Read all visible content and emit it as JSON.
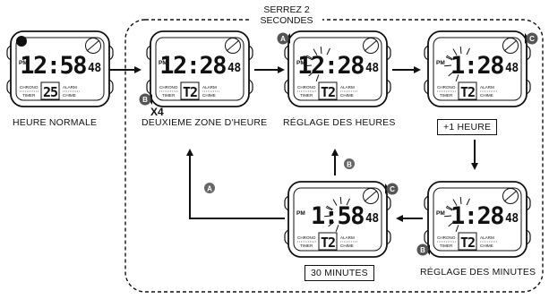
{
  "title_line1": "SERREZ 2",
  "title_line2": "SECONDES",
  "labels": {
    "normal": "HEURE NORMALE",
    "second_zone": "DEUXIEME ZONE D'HEURE",
    "hours_setting": "RÉGLAGE DES HEURES",
    "plus_one_hour": "+1 HEURE",
    "minutes_setting": "RÉGLAGE DES MINUTES",
    "thirty_minutes": "30 MINUTES",
    "x4": "X4"
  },
  "buttons": {
    "a": "A",
    "b": "B",
    "c": "C"
  },
  "watches": [
    {
      "pm": "PM",
      "time": "12:58",
      "sec": "48",
      "mode_left_top": "CHRONO",
      "mode_left_bottom": "TIMER",
      "sub": "25",
      "mode_right_top": "ALARM",
      "mode_right_bottom": "CHIME"
    },
    {
      "pm": "PM",
      "time": "12:28",
      "sec": "48",
      "mode_left_top": "CHRONO",
      "mode_left_bottom": "TIMER",
      "sub": "T2",
      "mode_right_top": "ALARM",
      "mode_right_bottom": "CHIME"
    },
    {
      "pm": "PM",
      "time": "12:28",
      "sec": "48",
      "mode_left_top": "CHRONO",
      "mode_left_bottom": "TIMER",
      "sub": "T2",
      "mode_right_top": "ALARM",
      "mode_right_bottom": "CHIME"
    },
    {
      "pm": "PM",
      "time": "1:28",
      "sec": "48",
      "mode_left_top": "CHRONO",
      "mode_left_bottom": "TIMER",
      "sub": "T2",
      "mode_right_top": "ALARM",
      "mode_right_bottom": "CHIME"
    },
    {
      "pm": "PM",
      "time": "1:28",
      "sec": "48",
      "mode_left_top": "CHRONO",
      "mode_left_bottom": "TIMER",
      "sub": "T2",
      "mode_right_top": "ALARM",
      "mode_right_bottom": "CHIME"
    },
    {
      "pm": "PM",
      "time": "1:58",
      "sec": "48",
      "mode_left_top": "CHRONO",
      "mode_left_bottom": "TIMER",
      "sub": "T2",
      "mode_right_top": "ALARM",
      "mode_right_bottom": "CHIME"
    }
  ]
}
